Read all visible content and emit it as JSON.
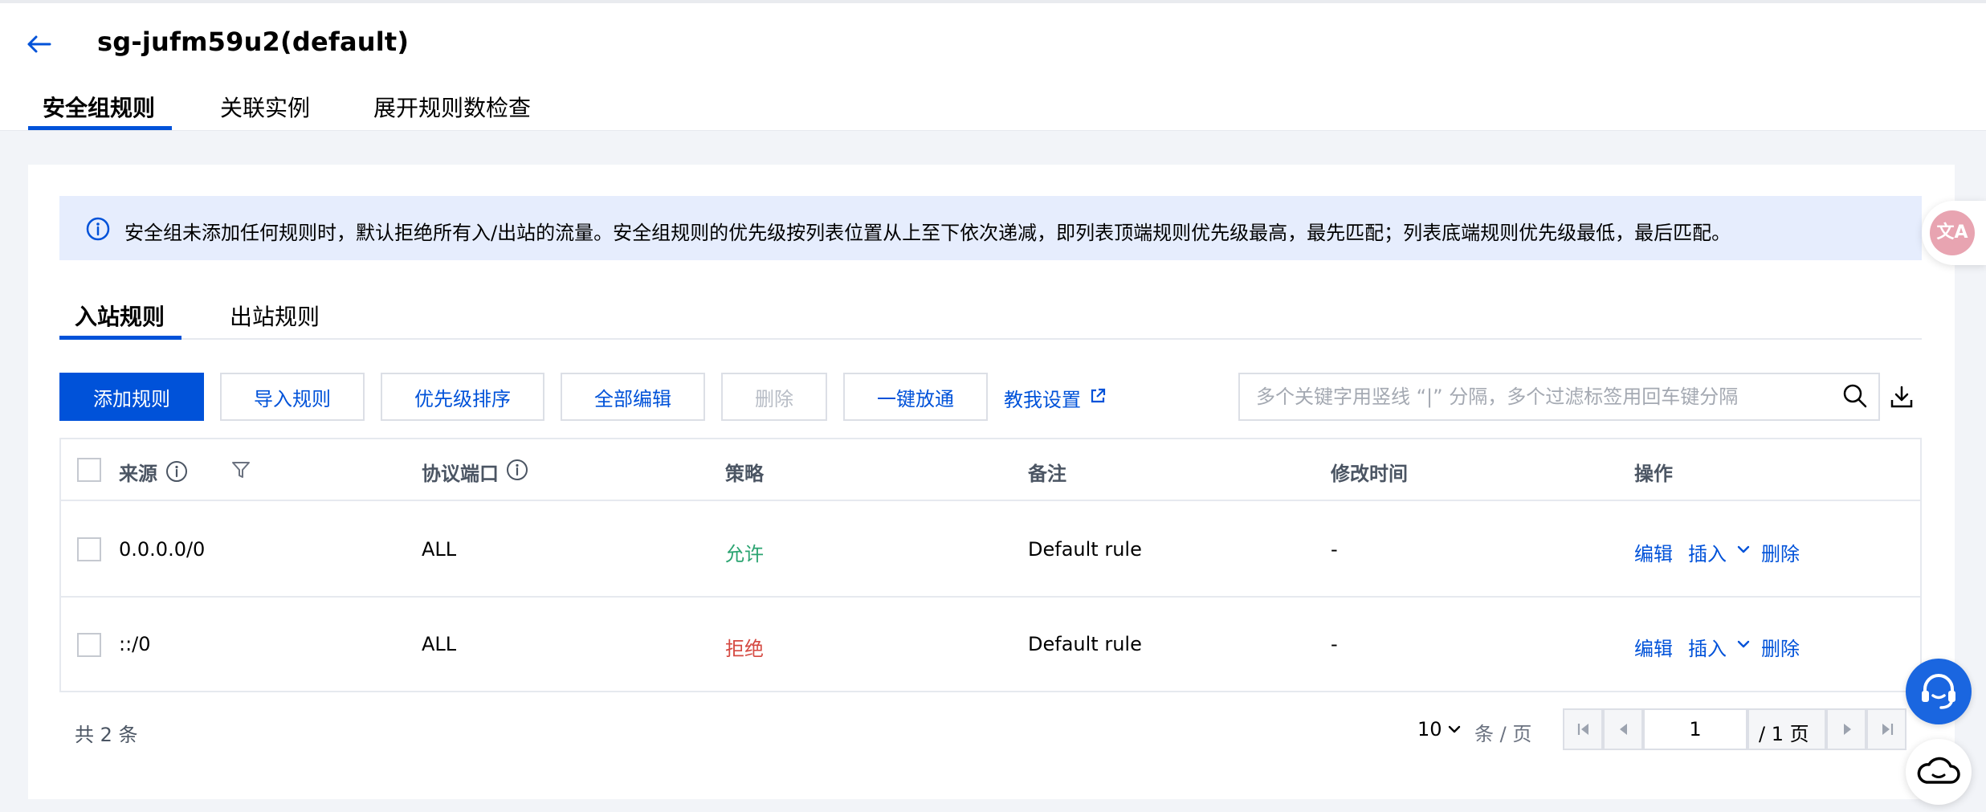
{
  "header": {
    "title": "sg-jufm59u2(default)",
    "tabs": [
      {
        "label": "安全组规则",
        "active": true
      },
      {
        "label": "关联实例",
        "active": false
      },
      {
        "label": "展开规则数检查",
        "active": false
      }
    ]
  },
  "notice": {
    "text": "安全组未添加任何规则时，默认拒绝所有入/出站的流量。安全组规则的优先级按列表位置从上至下依次递减，即列表顶端规则优先级最高，最先匹配；列表底端规则优先级最低，最后匹配。"
  },
  "subtabs": [
    {
      "label": "入站规则",
      "active": true
    },
    {
      "label": "出站规则",
      "active": false
    }
  ],
  "toolbar": {
    "add_rule": "添加规则",
    "import_rule": "导入规则",
    "priority_sort": "优先级排序",
    "edit_all": "全部编辑",
    "delete": "删除",
    "one_click_allow": "一键放通",
    "teach_me": "教我设置",
    "search_placeholder": "多个关键字用竖线 “|” 分隔，多个过滤标签用回车键分隔"
  },
  "table": {
    "headers": {
      "source": "来源",
      "protocol_port": "协议端口",
      "policy": "策略",
      "remark": "备注",
      "modified_time": "修改时间",
      "operation": "操作"
    },
    "rows": [
      {
        "source": "0.0.0.0/0",
        "protocol_port": "ALL",
        "policy": "允许",
        "remark": "Default rule",
        "modified_time": "-",
        "ops": {
          "edit": "编辑",
          "insert": "插入",
          "delete": "删除"
        }
      },
      {
        "source": "::/0",
        "protocol_port": "ALL",
        "policy": "拒绝",
        "remark": "Default rule",
        "modified_time": "-",
        "ops": {
          "edit": "编辑",
          "insert": "插入",
          "delete": "删除"
        }
      }
    ]
  },
  "pagination": {
    "total": "共 2 条",
    "page_size": "10",
    "per_page_label": "条 / 页",
    "current_page": "1",
    "total_pages": "/ 1 页"
  },
  "floating": {
    "translate_label": "文A"
  },
  "colors": {
    "primary": "#0052d9",
    "allow": "#2ba471",
    "deny": "#d54941",
    "notice_bg": "#e6edfd"
  }
}
